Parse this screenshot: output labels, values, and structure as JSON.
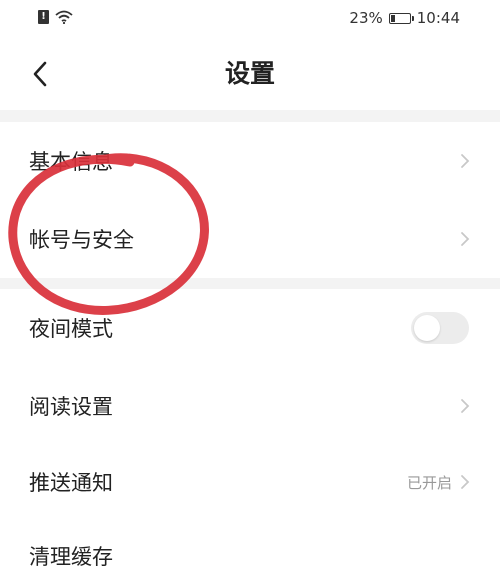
{
  "status_bar": {
    "sim_icon": "sim-alert-icon",
    "wifi_icon": "wifi-icon",
    "battery_percent": "23%",
    "battery_level": 0.23,
    "time": "10:44"
  },
  "nav": {
    "back_icon": "chevron-left-icon",
    "title": "设置"
  },
  "groups": [
    {
      "items": [
        {
          "label": "基本信息",
          "control": "chevron"
        },
        {
          "label": "帐号与安全",
          "control": "chevron"
        }
      ]
    },
    {
      "items": [
        {
          "label": "夜间模式",
          "control": "toggle",
          "toggle_on": false
        },
        {
          "label": "阅读设置",
          "control": "chevron"
        },
        {
          "label": "推送通知",
          "control": "chevron",
          "status": "已开启"
        },
        {
          "label": "清理缓存",
          "control": "none"
        }
      ]
    }
  ],
  "colors": {
    "annotation_circle": "#d9303a",
    "divider": "#f3f3f3",
    "chevron": "#c8c8c8",
    "toggle_off": "#ececec"
  }
}
